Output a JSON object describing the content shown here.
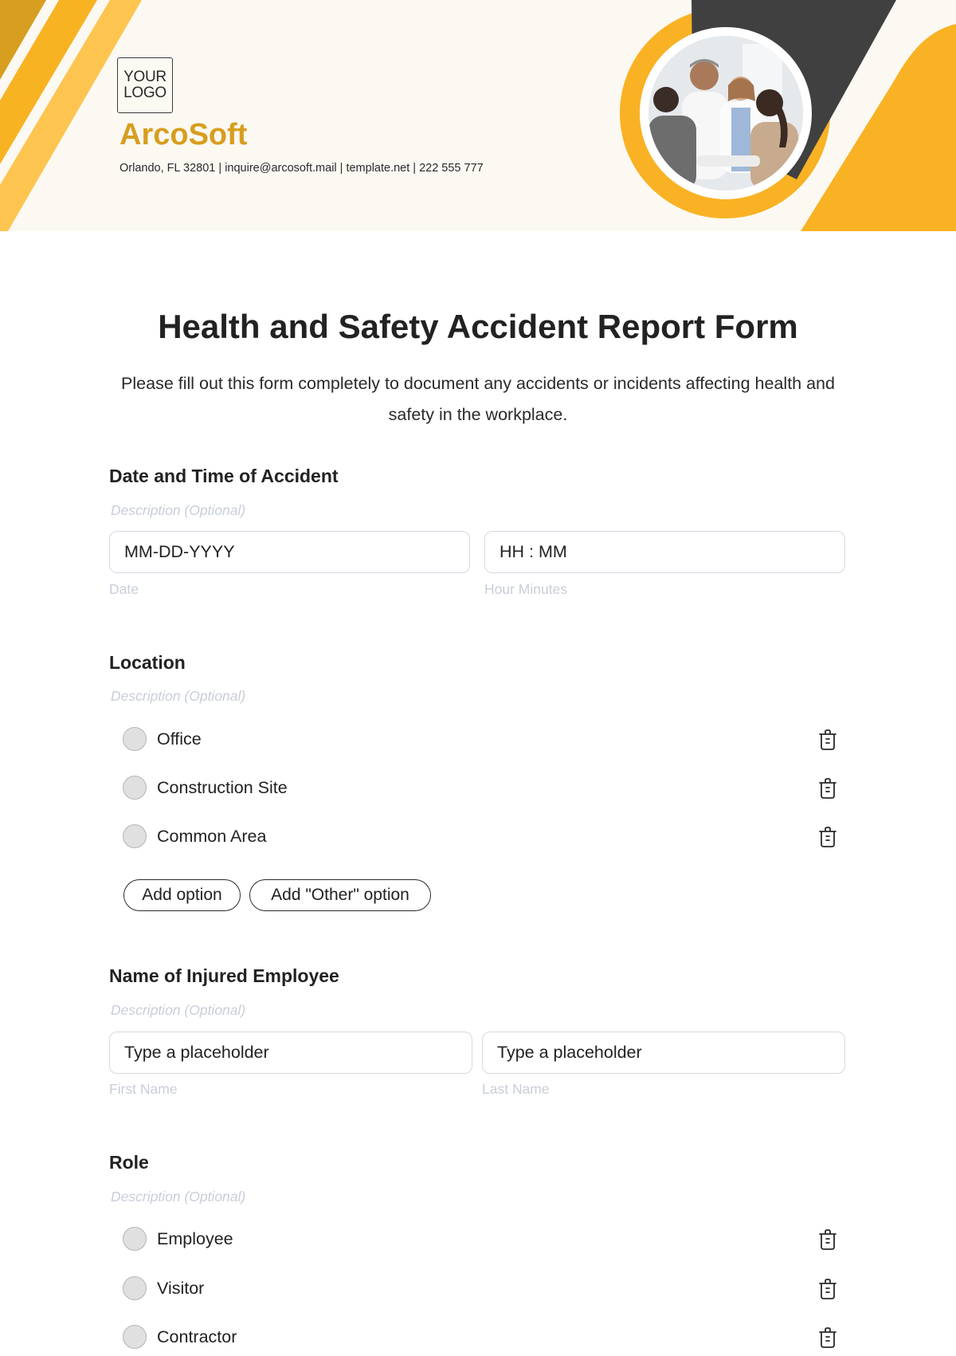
{
  "header": {
    "logo_line1": "YOUR",
    "logo_line2": "LOGO",
    "brand": "ArcoSoft",
    "contact": "Orlando, FL 32801 | inquire@arcosoft.mail | template.net | 222 555 777",
    "colors": {
      "background": "#fcf9f3",
      "stripe_dark": "#d79e1f",
      "stripe_mid": "#f8b323",
      "stripe_light": "#fdc550",
      "accent_orange": "#f9b224",
      "dark_band": "#404040",
      "brand_text": "#d79e1f"
    },
    "photo_alt": "Doctors greeting patients in a clinic"
  },
  "form": {
    "title": "Health and Safety Accident Report Form",
    "subtitle": "Please fill out this form completely to document any accidents or incidents affecting health and safety in the workplace.",
    "sections": {
      "datetime": {
        "title": "Date and Time of Accident",
        "description": "Description (Optional)",
        "date_placeholder": "MM-DD-YYYY",
        "date_label": "Date",
        "time_placeholder": "HH : MM",
        "time_label": "Hour Minutes"
      },
      "location": {
        "title": "Location",
        "description": "Description (Optional)",
        "options": [
          "Office",
          "Construction Site",
          "Common Area"
        ],
        "add_option": "Add option",
        "add_other_option": "Add \"Other\" option"
      },
      "name": {
        "title": "Name of Injured Employee",
        "description": "Description (Optional)",
        "first_placeholder": "Type a placeholder",
        "first_label": "First Name",
        "last_placeholder": "Type a placeholder",
        "last_label": "Last Name"
      },
      "role": {
        "title": "Role",
        "description": "Description (Optional)",
        "options": [
          "Employee",
          "Visitor",
          "Contractor"
        ]
      }
    }
  },
  "icons": {
    "delete": "trash-icon",
    "radio": "radio-unselected"
  }
}
